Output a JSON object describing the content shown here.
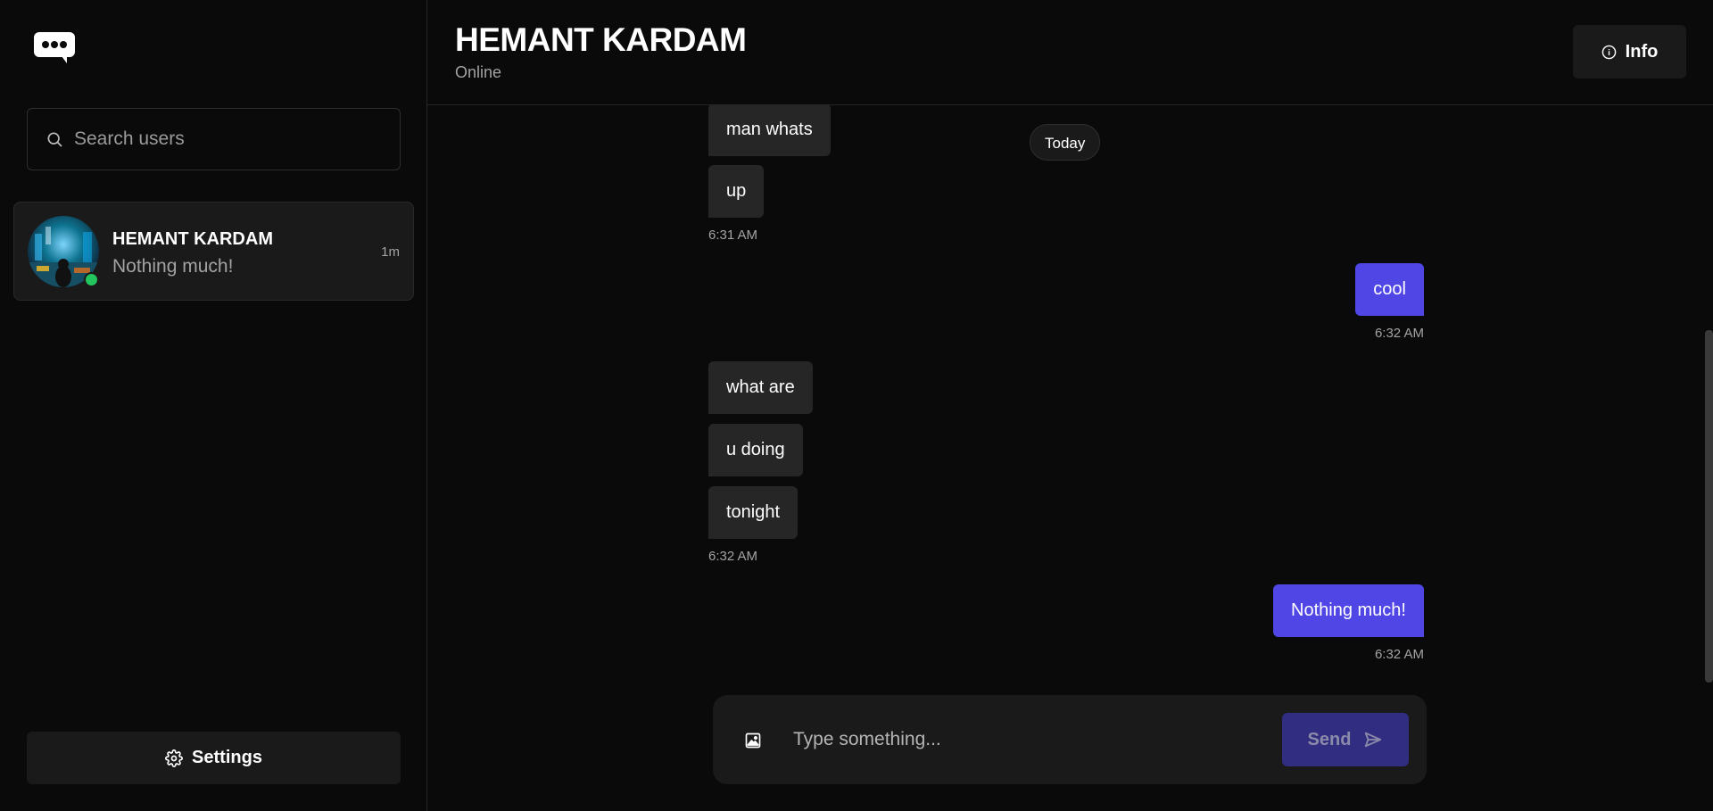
{
  "sidebar": {
    "search_placeholder": "Search users",
    "conversations": [
      {
        "name": "HEMANT KARDAM",
        "last_message": "Nothing much!",
        "time": "1m",
        "status": "online"
      }
    ],
    "settings_label": "Settings"
  },
  "header": {
    "title": "HEMANT KARDAM",
    "status": "Online",
    "info_label": "Info"
  },
  "chat": {
    "date_divider": "Today",
    "messages": [
      {
        "direction": "in",
        "text": "man whats"
      },
      {
        "direction": "in",
        "text": "up",
        "time": "6:31 AM"
      },
      {
        "direction": "out",
        "text": "cool",
        "time": "6:32 AM"
      },
      {
        "direction": "in",
        "text": "what are"
      },
      {
        "direction": "in",
        "text": "u doing"
      },
      {
        "direction": "in",
        "text": "tonight",
        "time": "6:32 AM"
      },
      {
        "direction": "out",
        "text": "Nothing much!",
        "time": "6:32 AM"
      }
    ]
  },
  "composer": {
    "placeholder": "Type something...",
    "send_label": "Send"
  },
  "colors": {
    "accent": "#4f46e5",
    "online": "#22c55e",
    "background": "#0a0a0a"
  },
  "icons": [
    "chat-logo-icon",
    "search-icon",
    "settings-gear-icon",
    "info-icon",
    "image-icon",
    "send-icon"
  ]
}
